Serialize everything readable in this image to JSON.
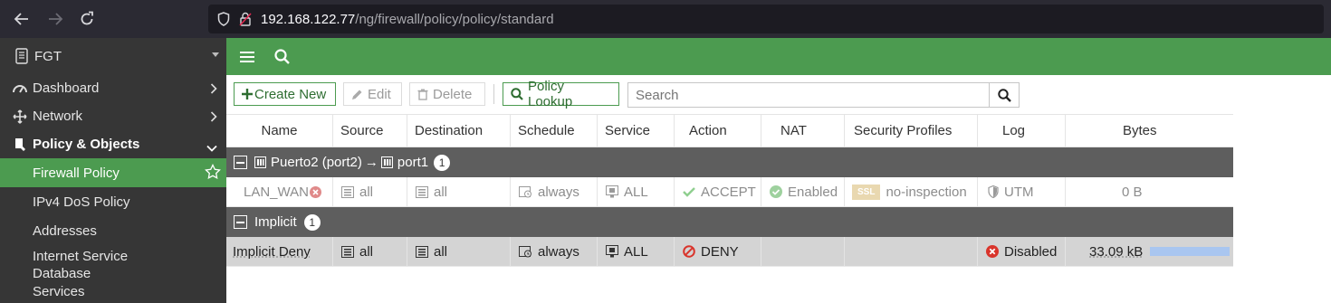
{
  "browser": {
    "url_host": "192.168.122.77",
    "url_path": "/ng/firewall/policy/policy/standard"
  },
  "sidebar": {
    "device": "FGT",
    "items": [
      {
        "label": "Dashboard"
      },
      {
        "label": "Network"
      },
      {
        "label": "Policy & Objects"
      }
    ],
    "subitems": [
      {
        "label": "Firewall Policy"
      },
      {
        "label": "IPv4 DoS Policy"
      },
      {
        "label": "Addresses"
      },
      {
        "label": "Internet Service Database"
      },
      {
        "label": "Services"
      }
    ]
  },
  "toolbar": {
    "create_new": "Create New",
    "edit": "Edit",
    "delete": "Delete",
    "policy_lookup": "Policy Lookup",
    "search_placeholder": "Search"
  },
  "table": {
    "headers": [
      "Name",
      "Source",
      "Destination",
      "Schedule",
      "Service",
      "Action",
      "NAT",
      "Security Profiles",
      "Log",
      "Bytes"
    ],
    "groups": [
      {
        "label_from": "Puerto2 (port2)",
        "arrow": "→",
        "label_to": "port1",
        "count": "1",
        "rows": [
          {
            "name": "LAN_WAN",
            "source": "all",
            "destination": "all",
            "schedule": "always",
            "service": "ALL",
            "action": "ACCEPT",
            "nat": "Enabled",
            "ssl_badge": "SSL",
            "security": "no-inspection",
            "log": "UTM",
            "bytes": "0 B"
          }
        ]
      },
      {
        "label": "Implicit",
        "count": "1",
        "rows": [
          {
            "name": "Implicit Deny",
            "source": "all",
            "destination": "all",
            "schedule": "always",
            "service": "ALL",
            "action": "DENY",
            "log": "Disabled",
            "bytes": "33.09 kB",
            "bytes_fraction": 1.0
          }
        ]
      }
    ]
  },
  "colors": {
    "brand_green": "#4c9b50",
    "sidebar_bg": "#363636",
    "group_bg": "#5e5e5e",
    "deny_red": "#d9342b",
    "accept_green": "#5cb85c",
    "bytes_bar": "#a9c6f0"
  },
  "icons": [
    "back-icon",
    "forward-icon",
    "reload-icon",
    "shield-icon",
    "lock-icon",
    "menu-icon",
    "search-icon",
    "dashboard-icon",
    "network-icon",
    "policy-icon",
    "star-icon",
    "plus-icon",
    "pencil-icon",
    "trash-icon",
    "address-icon",
    "schedule-icon",
    "service-icon",
    "check-icon",
    "deny-icon",
    "utm-icon",
    "disabled-icon"
  ]
}
